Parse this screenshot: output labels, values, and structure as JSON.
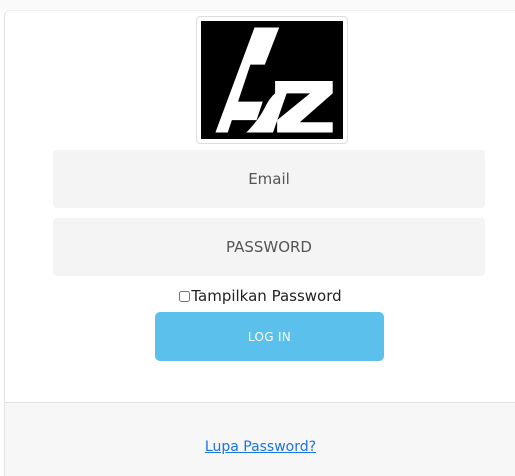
{
  "login": {
    "logo_alt": "AZ",
    "email_placeholder": "Email",
    "password_placeholder": "PASSWORD",
    "show_password_label": "Tampilkan Password",
    "show_password_checked": false,
    "login_button_label": "LOG IN",
    "forgot_password_link": "Lupa Password?"
  },
  "colors": {
    "button_bg": "#5bc0eb",
    "field_bg": "#f4f4f4",
    "link": "#1a73e8",
    "footer_bg": "#f7f7f7"
  },
  "icons": {
    "logo": "az-logo-icon"
  }
}
